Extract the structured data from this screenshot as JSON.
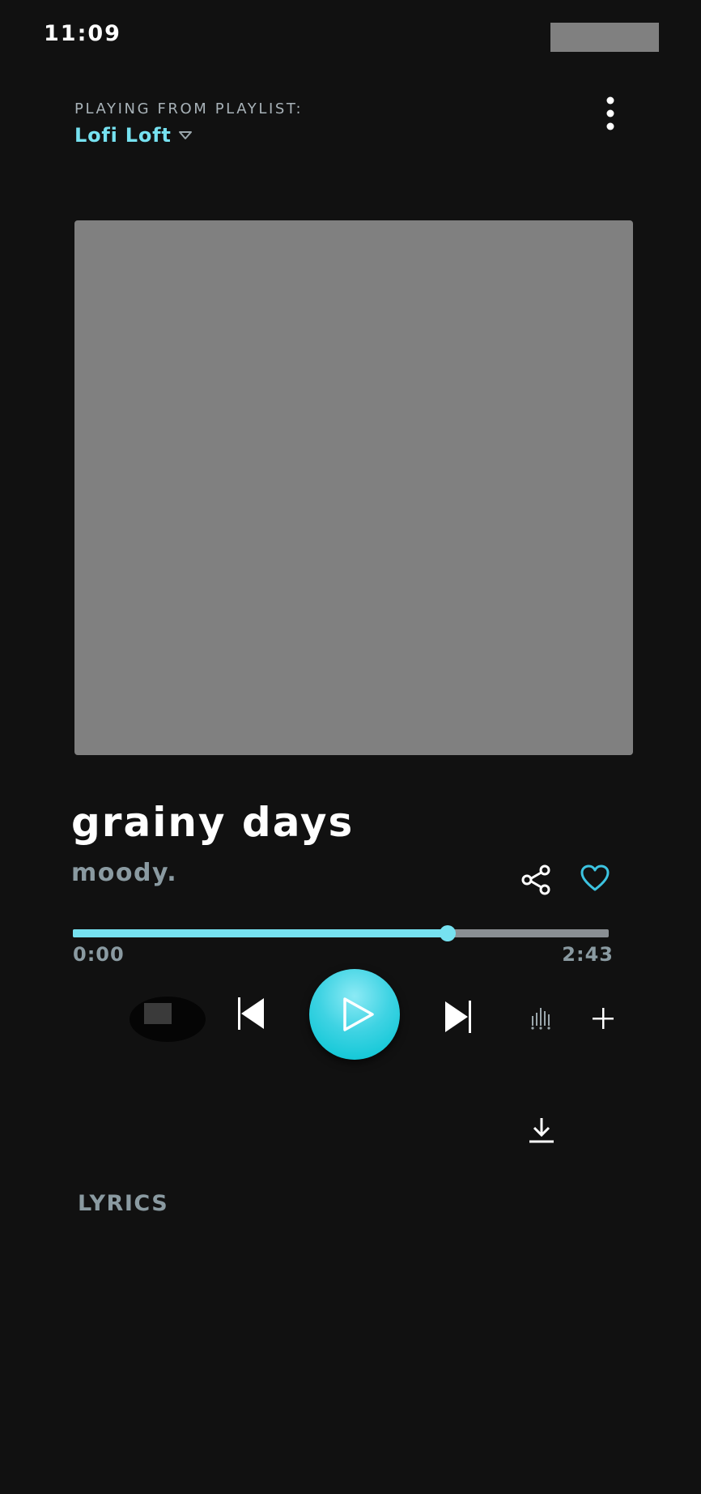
{
  "status_bar": {
    "time": "11:09"
  },
  "header": {
    "playing_from_label": "PLAYING FROM PLAYLIST:",
    "playlist_name": "Lofi Loft"
  },
  "track": {
    "title": "grainy days",
    "artist": "moody."
  },
  "progress": {
    "elapsed": "0:00",
    "total": "2:43",
    "fraction": 0.7
  },
  "lyrics": {
    "heading": "LYRICS"
  },
  "colors": {
    "accent": "#76e1f0",
    "background": "#111111",
    "muted_text": "#8a9aa1",
    "artwork_placeholder": "#808080"
  },
  "icons": {
    "more": "more-vertical-icon",
    "playlist_caret": "caret-down-icon",
    "share": "share-icon",
    "favorite": "heart-icon",
    "previous": "skip-previous-icon",
    "play": "play-icon",
    "next": "skip-next-icon",
    "equalizer": "equalizer-icon",
    "add": "plus-icon",
    "download": "download-icon"
  }
}
